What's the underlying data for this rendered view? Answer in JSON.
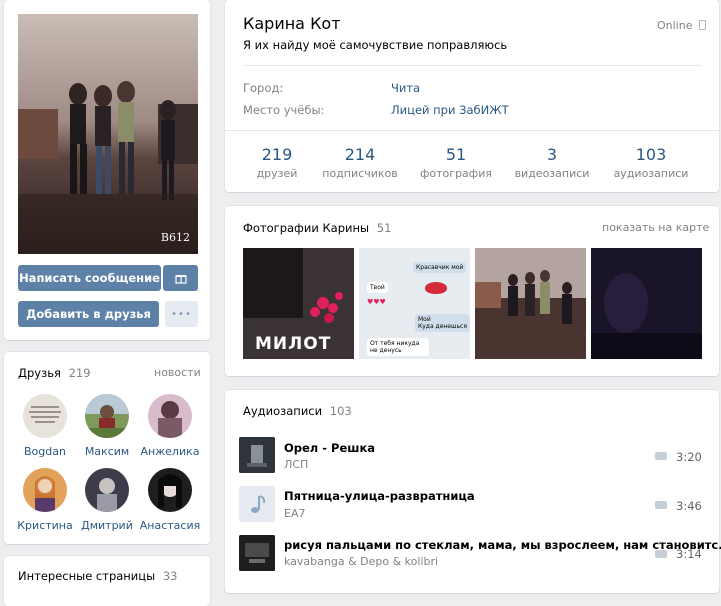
{
  "profile": {
    "name": "Карина Кот",
    "status": "Я их найду моё самочувствие поправляюсь",
    "online": "Online",
    "info": [
      {
        "label": "Город:",
        "value": "Чита"
      },
      {
        "label": "Место учёбы:",
        "value": "Лицей при ЗабИЖТ"
      }
    ],
    "stats": [
      {
        "num": "219",
        "label": "друзей"
      },
      {
        "num": "214",
        "label": "подписчиков"
      },
      {
        "num": "51",
        "label": "фотография"
      },
      {
        "num": "3",
        "label": "видеозаписи"
      },
      {
        "num": "103",
        "label": "аудиозаписи"
      }
    ],
    "avatar_caption": "B612"
  },
  "actions": {
    "write_message": "Написать сообщение",
    "add_friend": "Добавить в друзья",
    "more": "•••"
  },
  "friends": {
    "title": "Друзья",
    "count": "219",
    "news_link": "новости",
    "items": [
      {
        "name": "Bogdan",
        "color": "#e7e2da"
      },
      {
        "name": "Максим",
        "color": "#6f8f4a"
      },
      {
        "name": "Анжелика",
        "color": "#c9a6b8"
      },
      {
        "name": "Кристина",
        "color": "#d9883a"
      },
      {
        "name": "Дмитрий",
        "color": "#4b4b5a"
      },
      {
        "name": "Анастасия",
        "color": "#2a2a2a"
      }
    ]
  },
  "interesting_pages": {
    "title": "Интересные страницы",
    "count": "33"
  },
  "photos": {
    "title": "Фотографии Карины",
    "count": "51",
    "map_link": "показать на карте",
    "chat_lines": [
      "Красавчик мой",
      "Твой",
      "Мой",
      "Куда денешься",
      "От тебя никуда не денусь"
    ],
    "photo1_text": "МИЛОТ"
  },
  "audio": {
    "title": "Аудиозаписи",
    "count": "103",
    "tracks": [
      {
        "title": "Орел - Решка",
        "artist": "ЛСП",
        "duration": "3:20"
      },
      {
        "title": "Пятница-улица-развратница",
        "artist": "EA7",
        "duration": "3:46"
      },
      {
        "title": "рисуя пальцами по стеклам, мама, мы взрослеем, нам становитс...",
        "artist": "kavabanga & Depo & kolibri",
        "duration": "3:14"
      }
    ]
  }
}
